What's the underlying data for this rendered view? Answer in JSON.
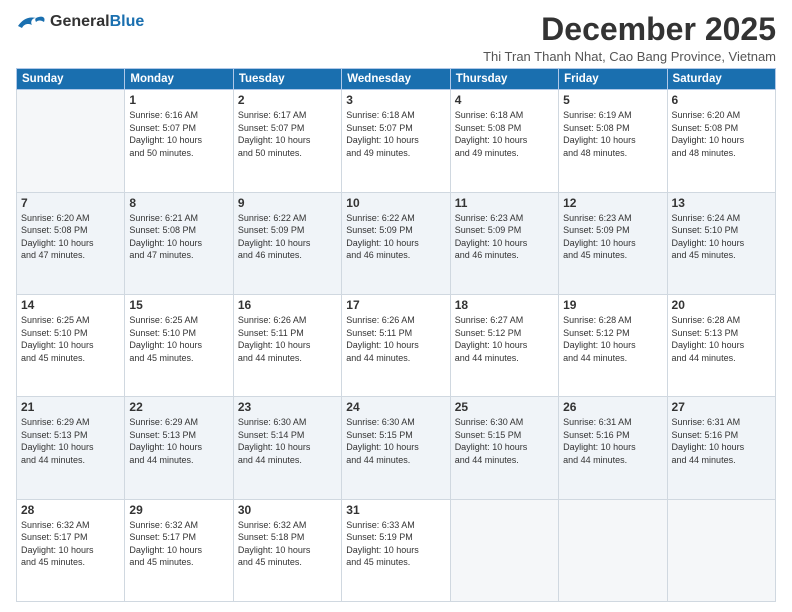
{
  "logo": {
    "general": "General",
    "blue": "Blue",
    "tagline": ""
  },
  "header": {
    "month_title": "December 2025",
    "subtitle": "Thi Tran Thanh Nhat, Cao Bang Province, Vietnam"
  },
  "weekdays": [
    "Sunday",
    "Monday",
    "Tuesday",
    "Wednesday",
    "Thursday",
    "Friday",
    "Saturday"
  ],
  "weeks": [
    [
      {
        "day": "",
        "info": ""
      },
      {
        "day": "1",
        "info": "Sunrise: 6:16 AM\nSunset: 5:07 PM\nDaylight: 10 hours\nand 50 minutes."
      },
      {
        "day": "2",
        "info": "Sunrise: 6:17 AM\nSunset: 5:07 PM\nDaylight: 10 hours\nand 50 minutes."
      },
      {
        "day": "3",
        "info": "Sunrise: 6:18 AM\nSunset: 5:07 PM\nDaylight: 10 hours\nand 49 minutes."
      },
      {
        "day": "4",
        "info": "Sunrise: 6:18 AM\nSunset: 5:08 PM\nDaylight: 10 hours\nand 49 minutes."
      },
      {
        "day": "5",
        "info": "Sunrise: 6:19 AM\nSunset: 5:08 PM\nDaylight: 10 hours\nand 48 minutes."
      },
      {
        "day": "6",
        "info": "Sunrise: 6:20 AM\nSunset: 5:08 PM\nDaylight: 10 hours\nand 48 minutes."
      }
    ],
    [
      {
        "day": "7",
        "info": "Sunrise: 6:20 AM\nSunset: 5:08 PM\nDaylight: 10 hours\nand 47 minutes."
      },
      {
        "day": "8",
        "info": "Sunrise: 6:21 AM\nSunset: 5:08 PM\nDaylight: 10 hours\nand 47 minutes."
      },
      {
        "day": "9",
        "info": "Sunrise: 6:22 AM\nSunset: 5:09 PM\nDaylight: 10 hours\nand 46 minutes."
      },
      {
        "day": "10",
        "info": "Sunrise: 6:22 AM\nSunset: 5:09 PM\nDaylight: 10 hours\nand 46 minutes."
      },
      {
        "day": "11",
        "info": "Sunrise: 6:23 AM\nSunset: 5:09 PM\nDaylight: 10 hours\nand 46 minutes."
      },
      {
        "day": "12",
        "info": "Sunrise: 6:23 AM\nSunset: 5:09 PM\nDaylight: 10 hours\nand 45 minutes."
      },
      {
        "day": "13",
        "info": "Sunrise: 6:24 AM\nSunset: 5:10 PM\nDaylight: 10 hours\nand 45 minutes."
      }
    ],
    [
      {
        "day": "14",
        "info": "Sunrise: 6:25 AM\nSunset: 5:10 PM\nDaylight: 10 hours\nand 45 minutes."
      },
      {
        "day": "15",
        "info": "Sunrise: 6:25 AM\nSunset: 5:10 PM\nDaylight: 10 hours\nand 45 minutes."
      },
      {
        "day": "16",
        "info": "Sunrise: 6:26 AM\nSunset: 5:11 PM\nDaylight: 10 hours\nand 44 minutes."
      },
      {
        "day": "17",
        "info": "Sunrise: 6:26 AM\nSunset: 5:11 PM\nDaylight: 10 hours\nand 44 minutes."
      },
      {
        "day": "18",
        "info": "Sunrise: 6:27 AM\nSunset: 5:12 PM\nDaylight: 10 hours\nand 44 minutes."
      },
      {
        "day": "19",
        "info": "Sunrise: 6:28 AM\nSunset: 5:12 PM\nDaylight: 10 hours\nand 44 minutes."
      },
      {
        "day": "20",
        "info": "Sunrise: 6:28 AM\nSunset: 5:13 PM\nDaylight: 10 hours\nand 44 minutes."
      }
    ],
    [
      {
        "day": "21",
        "info": "Sunrise: 6:29 AM\nSunset: 5:13 PM\nDaylight: 10 hours\nand 44 minutes."
      },
      {
        "day": "22",
        "info": "Sunrise: 6:29 AM\nSunset: 5:13 PM\nDaylight: 10 hours\nand 44 minutes."
      },
      {
        "day": "23",
        "info": "Sunrise: 6:30 AM\nSunset: 5:14 PM\nDaylight: 10 hours\nand 44 minutes."
      },
      {
        "day": "24",
        "info": "Sunrise: 6:30 AM\nSunset: 5:15 PM\nDaylight: 10 hours\nand 44 minutes."
      },
      {
        "day": "25",
        "info": "Sunrise: 6:30 AM\nSunset: 5:15 PM\nDaylight: 10 hours\nand 44 minutes."
      },
      {
        "day": "26",
        "info": "Sunrise: 6:31 AM\nSunset: 5:16 PM\nDaylight: 10 hours\nand 44 minutes."
      },
      {
        "day": "27",
        "info": "Sunrise: 6:31 AM\nSunset: 5:16 PM\nDaylight: 10 hours\nand 44 minutes."
      }
    ],
    [
      {
        "day": "28",
        "info": "Sunrise: 6:32 AM\nSunset: 5:17 PM\nDaylight: 10 hours\nand 45 minutes."
      },
      {
        "day": "29",
        "info": "Sunrise: 6:32 AM\nSunset: 5:17 PM\nDaylight: 10 hours\nand 45 minutes."
      },
      {
        "day": "30",
        "info": "Sunrise: 6:32 AM\nSunset: 5:18 PM\nDaylight: 10 hours\nand 45 minutes."
      },
      {
        "day": "31",
        "info": "Sunrise: 6:33 AM\nSunset: 5:19 PM\nDaylight: 10 hours\nand 45 minutes."
      },
      {
        "day": "",
        "info": ""
      },
      {
        "day": "",
        "info": ""
      },
      {
        "day": "",
        "info": ""
      }
    ]
  ]
}
